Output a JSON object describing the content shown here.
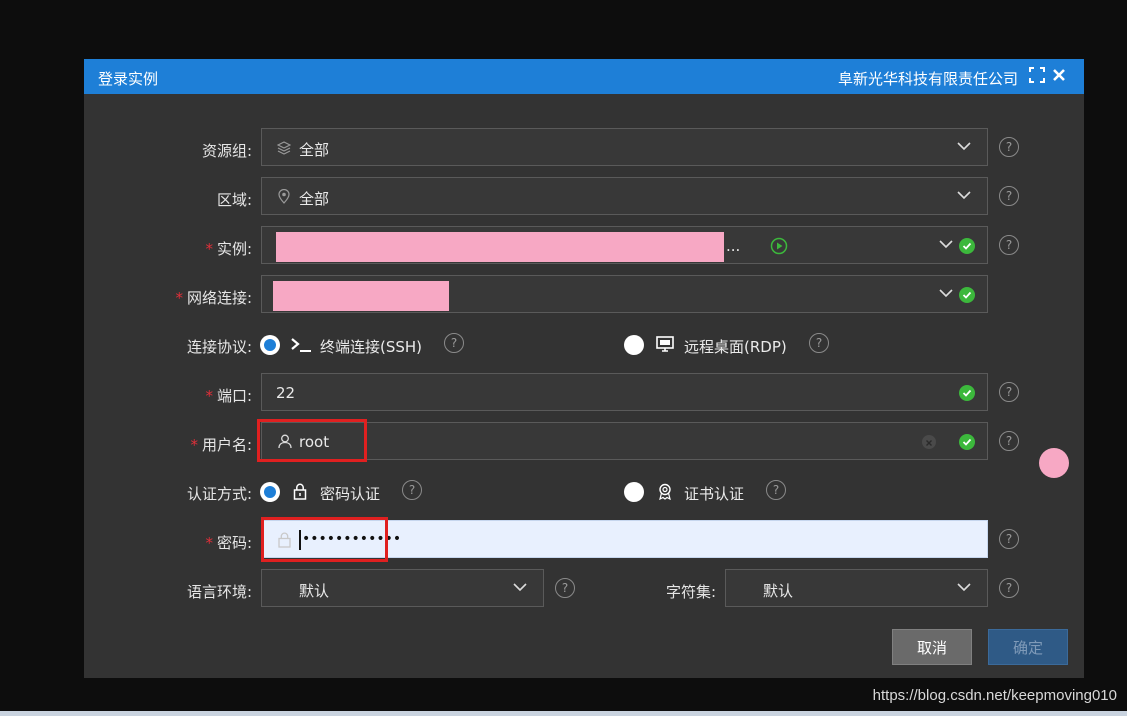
{
  "dialog": {
    "title": "登录实例",
    "company": "阜新光华科技有限责任公司",
    "fullscreen_icon": "fullscreen-icon",
    "close_icon": "close-icon"
  },
  "form": {
    "resource_group": {
      "label": "资源组:",
      "value": "全部",
      "icon": "layers-icon"
    },
    "region": {
      "label": "区域:",
      "value": "全部",
      "icon": "location-pin-icon"
    },
    "instance": {
      "label": "实例:",
      "required_mark": "*",
      "ellipsis": "..."
    },
    "network": {
      "label": "网络连接:",
      "required_mark": "*"
    },
    "protocol": {
      "label": "连接协议:",
      "options": [
        {
          "label": "终端连接(SSH)",
          "selected": true,
          "icon": "terminal-icon"
        },
        {
          "label": "远程桌面(RDP)",
          "selected": false,
          "icon": "monitor-icon"
        }
      ]
    },
    "port": {
      "label": "端口:",
      "required_mark": "*",
      "value": "22"
    },
    "username": {
      "label": "用户名:",
      "required_mark": "*",
      "value": "root",
      "icon": "user-icon"
    },
    "auth": {
      "label": "认证方式:",
      "options": [
        {
          "label": "密码认证",
          "selected": true,
          "icon": "lock-icon"
        },
        {
          "label": "证书认证",
          "selected": false,
          "icon": "certificate-icon"
        }
      ]
    },
    "password": {
      "label": "密码:",
      "required_mark": "*",
      "value": "••••••••••••"
    },
    "locale": {
      "label": "语言环境:",
      "value": "默认"
    },
    "charset": {
      "label": "字符集:",
      "value": "默认"
    }
  },
  "buttons": {
    "cancel": "取消",
    "confirm": "确定"
  },
  "watermark": "https://blog.csdn.net/keepmoving010",
  "colors": {
    "accent": "#1e7fd7",
    "success": "#3cb83c",
    "required": "#e0303a",
    "highlight": "#e02020"
  }
}
